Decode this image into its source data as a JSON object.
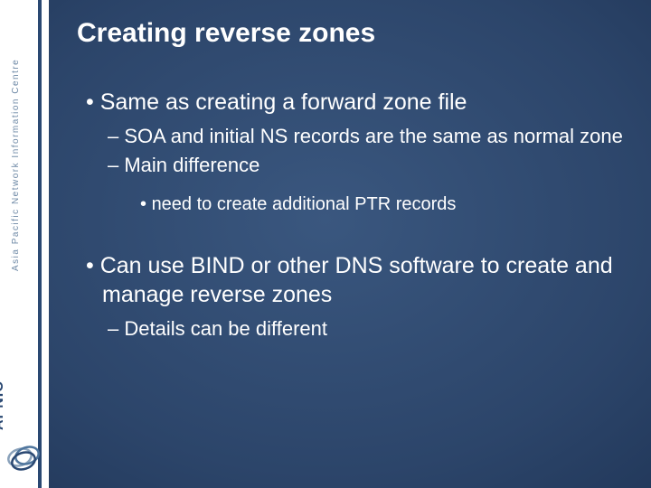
{
  "sidebar": {
    "org_vertical": "Asia Pacific Network Information Centre",
    "logo_text": "APNIC"
  },
  "slide": {
    "title": "Creating reverse zones",
    "bullets": {
      "p1": "Same as creating a forward zone file",
      "p1a": "SOA and initial NS records are the same as normal zone",
      "p1b": "Main difference",
      "p1b1": "need to create additional PTR records",
      "p2": "Can use BIND or other DNS software to create and manage reverse zones",
      "p2a": "Details can be different"
    }
  }
}
